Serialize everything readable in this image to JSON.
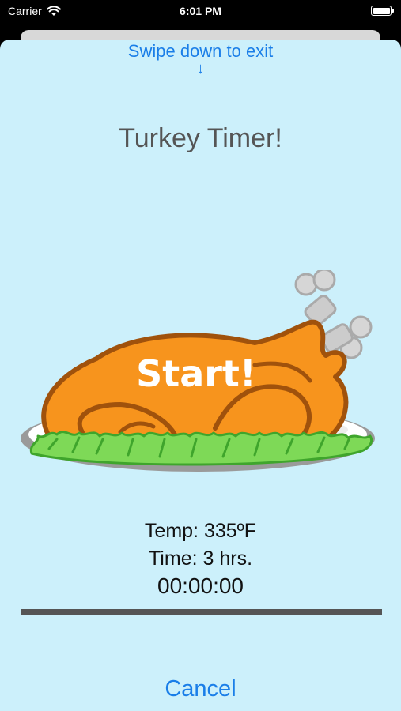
{
  "status_bar": {
    "carrier": "Carrier",
    "time": "6:01 PM",
    "battery_level": 1.0
  },
  "sheet": {
    "swipe_hint": "Swipe down to exit",
    "swipe_arrow": "↓",
    "title": "Turkey Timer!",
    "start_label": "Start!",
    "temp": "Temp: 335ºF",
    "time": "Time: 3 hrs.",
    "elapsed": "00:00:00",
    "progress": 1.0,
    "cancel_label": "Cancel"
  },
  "colors": {
    "background": "#ccf0fb",
    "accent": "#1a7ee8",
    "turkey": "#f7941d",
    "turkey_outline": "#a0520c",
    "lettuce": "#7ed957",
    "plate": "#888888"
  },
  "icons": {
    "wifi": "wifi-icon",
    "battery": "battery-icon",
    "turkey": "turkey-illustration"
  }
}
